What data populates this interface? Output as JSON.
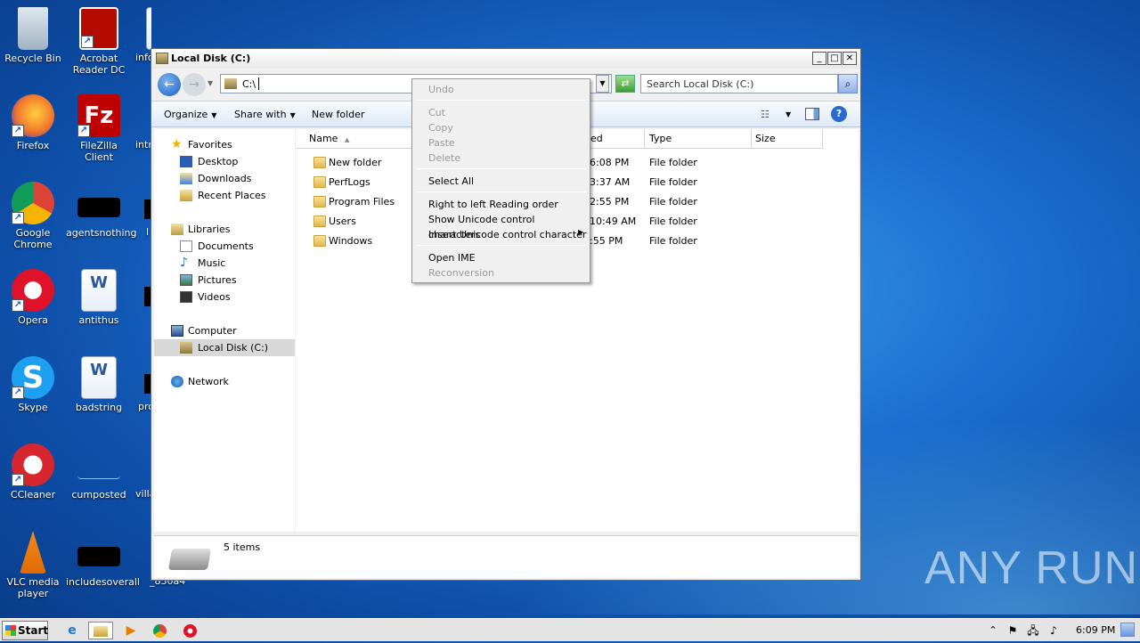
{
  "desktop": {
    "icons": [
      "Recycle Bin",
      "Acrobat Reader DC",
      "Firefox",
      "FileZilla Client",
      "Google Chrome",
      "agentsnothing",
      "Opera",
      "antithus",
      "Skype",
      "badstring",
      "CCleaner",
      "cumposted",
      "VLC media player",
      "includesoverall"
    ],
    "partial_labels": [
      "info",
      "intr",
      "l",
      "pro",
      "villa",
      "_830a4"
    ]
  },
  "window": {
    "title": "Local Disk (C:)",
    "address": "C:\\",
    "search_placeholder": "Search Local Disk (C:)",
    "toolbar": {
      "organize": "Organize",
      "share": "Share with",
      "new_folder": "New folder"
    },
    "nav": {
      "favorites": "Favorites",
      "desktop": "Desktop",
      "downloads": "Downloads",
      "recent": "Recent Places",
      "libraries": "Libraries",
      "documents": "Documents",
      "music": "Music",
      "pictures": "Pictures",
      "videos": "Videos",
      "computer": "Computer",
      "local_disk": "Local Disk (C:)",
      "network": "Network"
    },
    "columns": {
      "name": "Name",
      "date": "ed",
      "type": "Type",
      "size": "Size"
    },
    "rows": [
      {
        "name": "New folder",
        "date": "6:08 PM",
        "type": "File folder"
      },
      {
        "name": "PerfLogs",
        "date": "3:37 AM",
        "type": "File folder"
      },
      {
        "name": "Program Files",
        "date": "2:55 PM",
        "type": "File folder"
      },
      {
        "name": "Users",
        "date": "10:49 AM",
        "type": "File folder"
      },
      {
        "name": "Windows",
        "date": ":55 PM",
        "type": "File folder"
      }
    ],
    "status": "5 items"
  },
  "context_menu": {
    "undo": "Undo",
    "cut": "Cut",
    "copy": "Copy",
    "paste": "Paste",
    "delete": "Delete",
    "select_all": "Select All",
    "rtl": "Right to left Reading order",
    "show_unicode": "Show Unicode control characters",
    "insert_unicode": "Insert Unicode control character",
    "open_ime": "Open IME",
    "reconversion": "Reconversion"
  },
  "taskbar": {
    "start": "Start",
    "clock": "6:09 PM"
  },
  "watermark": "ANY RUN"
}
